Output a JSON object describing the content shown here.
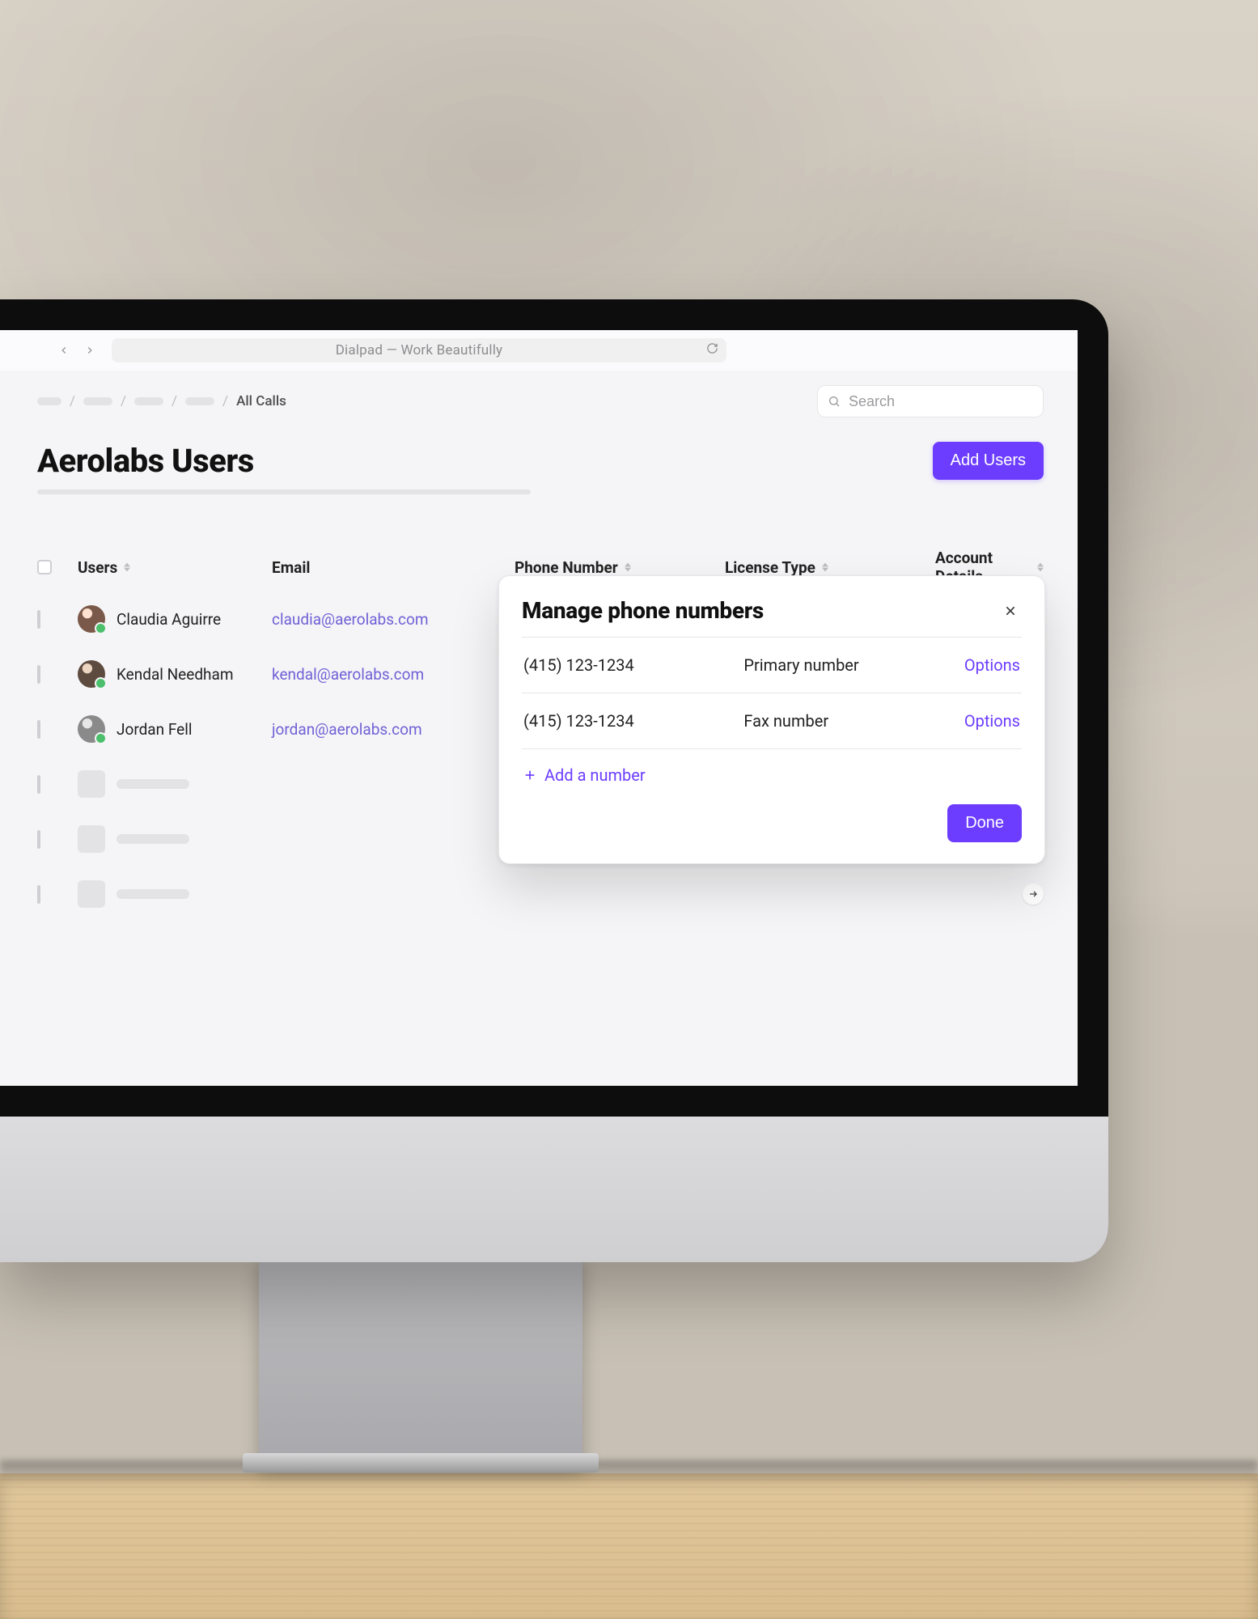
{
  "browser": {
    "address_title": "Dialpad — Work Beautifully"
  },
  "header": {
    "breadcrumb_current": "All Calls",
    "search_placeholder": "Search"
  },
  "page": {
    "title": "Aerolabs Users",
    "add_users_label": "Add Users"
  },
  "table": {
    "columns": {
      "users": "Users",
      "email": "Email",
      "phone": "Phone Number",
      "license": "License Type",
      "account": "Account Details"
    },
    "rows": [
      {
        "name": "Claudia Aguirre",
        "email": "claudia@aerolabs.com"
      },
      {
        "name": "Kendal Needham",
        "email": "kendal@aerolabs.com"
      },
      {
        "name": "Jordan Fell",
        "email": "jordan@aerolabs.com"
      }
    ]
  },
  "popover": {
    "title": "Manage phone numbers",
    "numbers": [
      {
        "phone": "(415) 123-1234",
        "type": "Primary number",
        "options_label": "Options"
      },
      {
        "phone": "(415) 123-1234",
        "type": "Fax number",
        "options_label": "Options"
      }
    ],
    "add_label": "Add a number",
    "done_label": "Done"
  }
}
